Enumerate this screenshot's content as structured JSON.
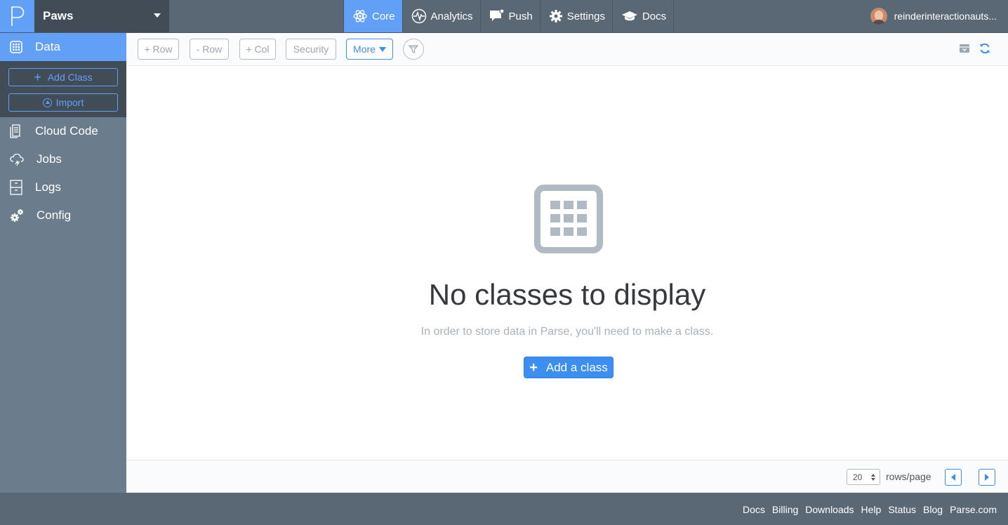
{
  "app": {
    "name": "Paws"
  },
  "nav": {
    "items": [
      {
        "label": "Core",
        "icon": "atom-icon",
        "active": true
      },
      {
        "label": "Analytics",
        "icon": "pulse-icon"
      },
      {
        "label": "Push",
        "icon": "chat-bubble-icon"
      },
      {
        "label": "Settings",
        "icon": "gear-icon"
      },
      {
        "label": "Docs",
        "icon": "graduation-cap-icon"
      }
    ],
    "user": "reinderinteractionauts..."
  },
  "sidebar": {
    "data_label": "Data",
    "add_class_label": "Add Class",
    "import_label": "Import",
    "items": [
      {
        "label": "Cloud Code",
        "icon": "document-icon"
      },
      {
        "label": "Jobs",
        "icon": "cloud-sync-icon"
      },
      {
        "label": "Logs",
        "icon": "cabinet-icon"
      },
      {
        "label": "Config",
        "icon": "gears-icon"
      }
    ]
  },
  "toolbar": {
    "add_row": "+ Row",
    "remove_row": "- Row",
    "add_col": "+ Col",
    "security": "Security",
    "more": "More"
  },
  "empty_state": {
    "title": "No classes to display",
    "description": "In order to store data in Parse, you'll need to make a class.",
    "button": "Add a class"
  },
  "pagination": {
    "rows_per_page": "20",
    "rows_label": "rows/page"
  },
  "footer": {
    "links": [
      "Docs",
      "Billing",
      "Downloads",
      "Help",
      "Status",
      "Blog",
      "Parse.com"
    ]
  },
  "colors": {
    "accent": "#62a0f8",
    "primary_button": "#3c8ef0",
    "topbar": "#5a6876",
    "sidebar": "#6b7d8c",
    "sidebar_dark": "#414c57"
  }
}
